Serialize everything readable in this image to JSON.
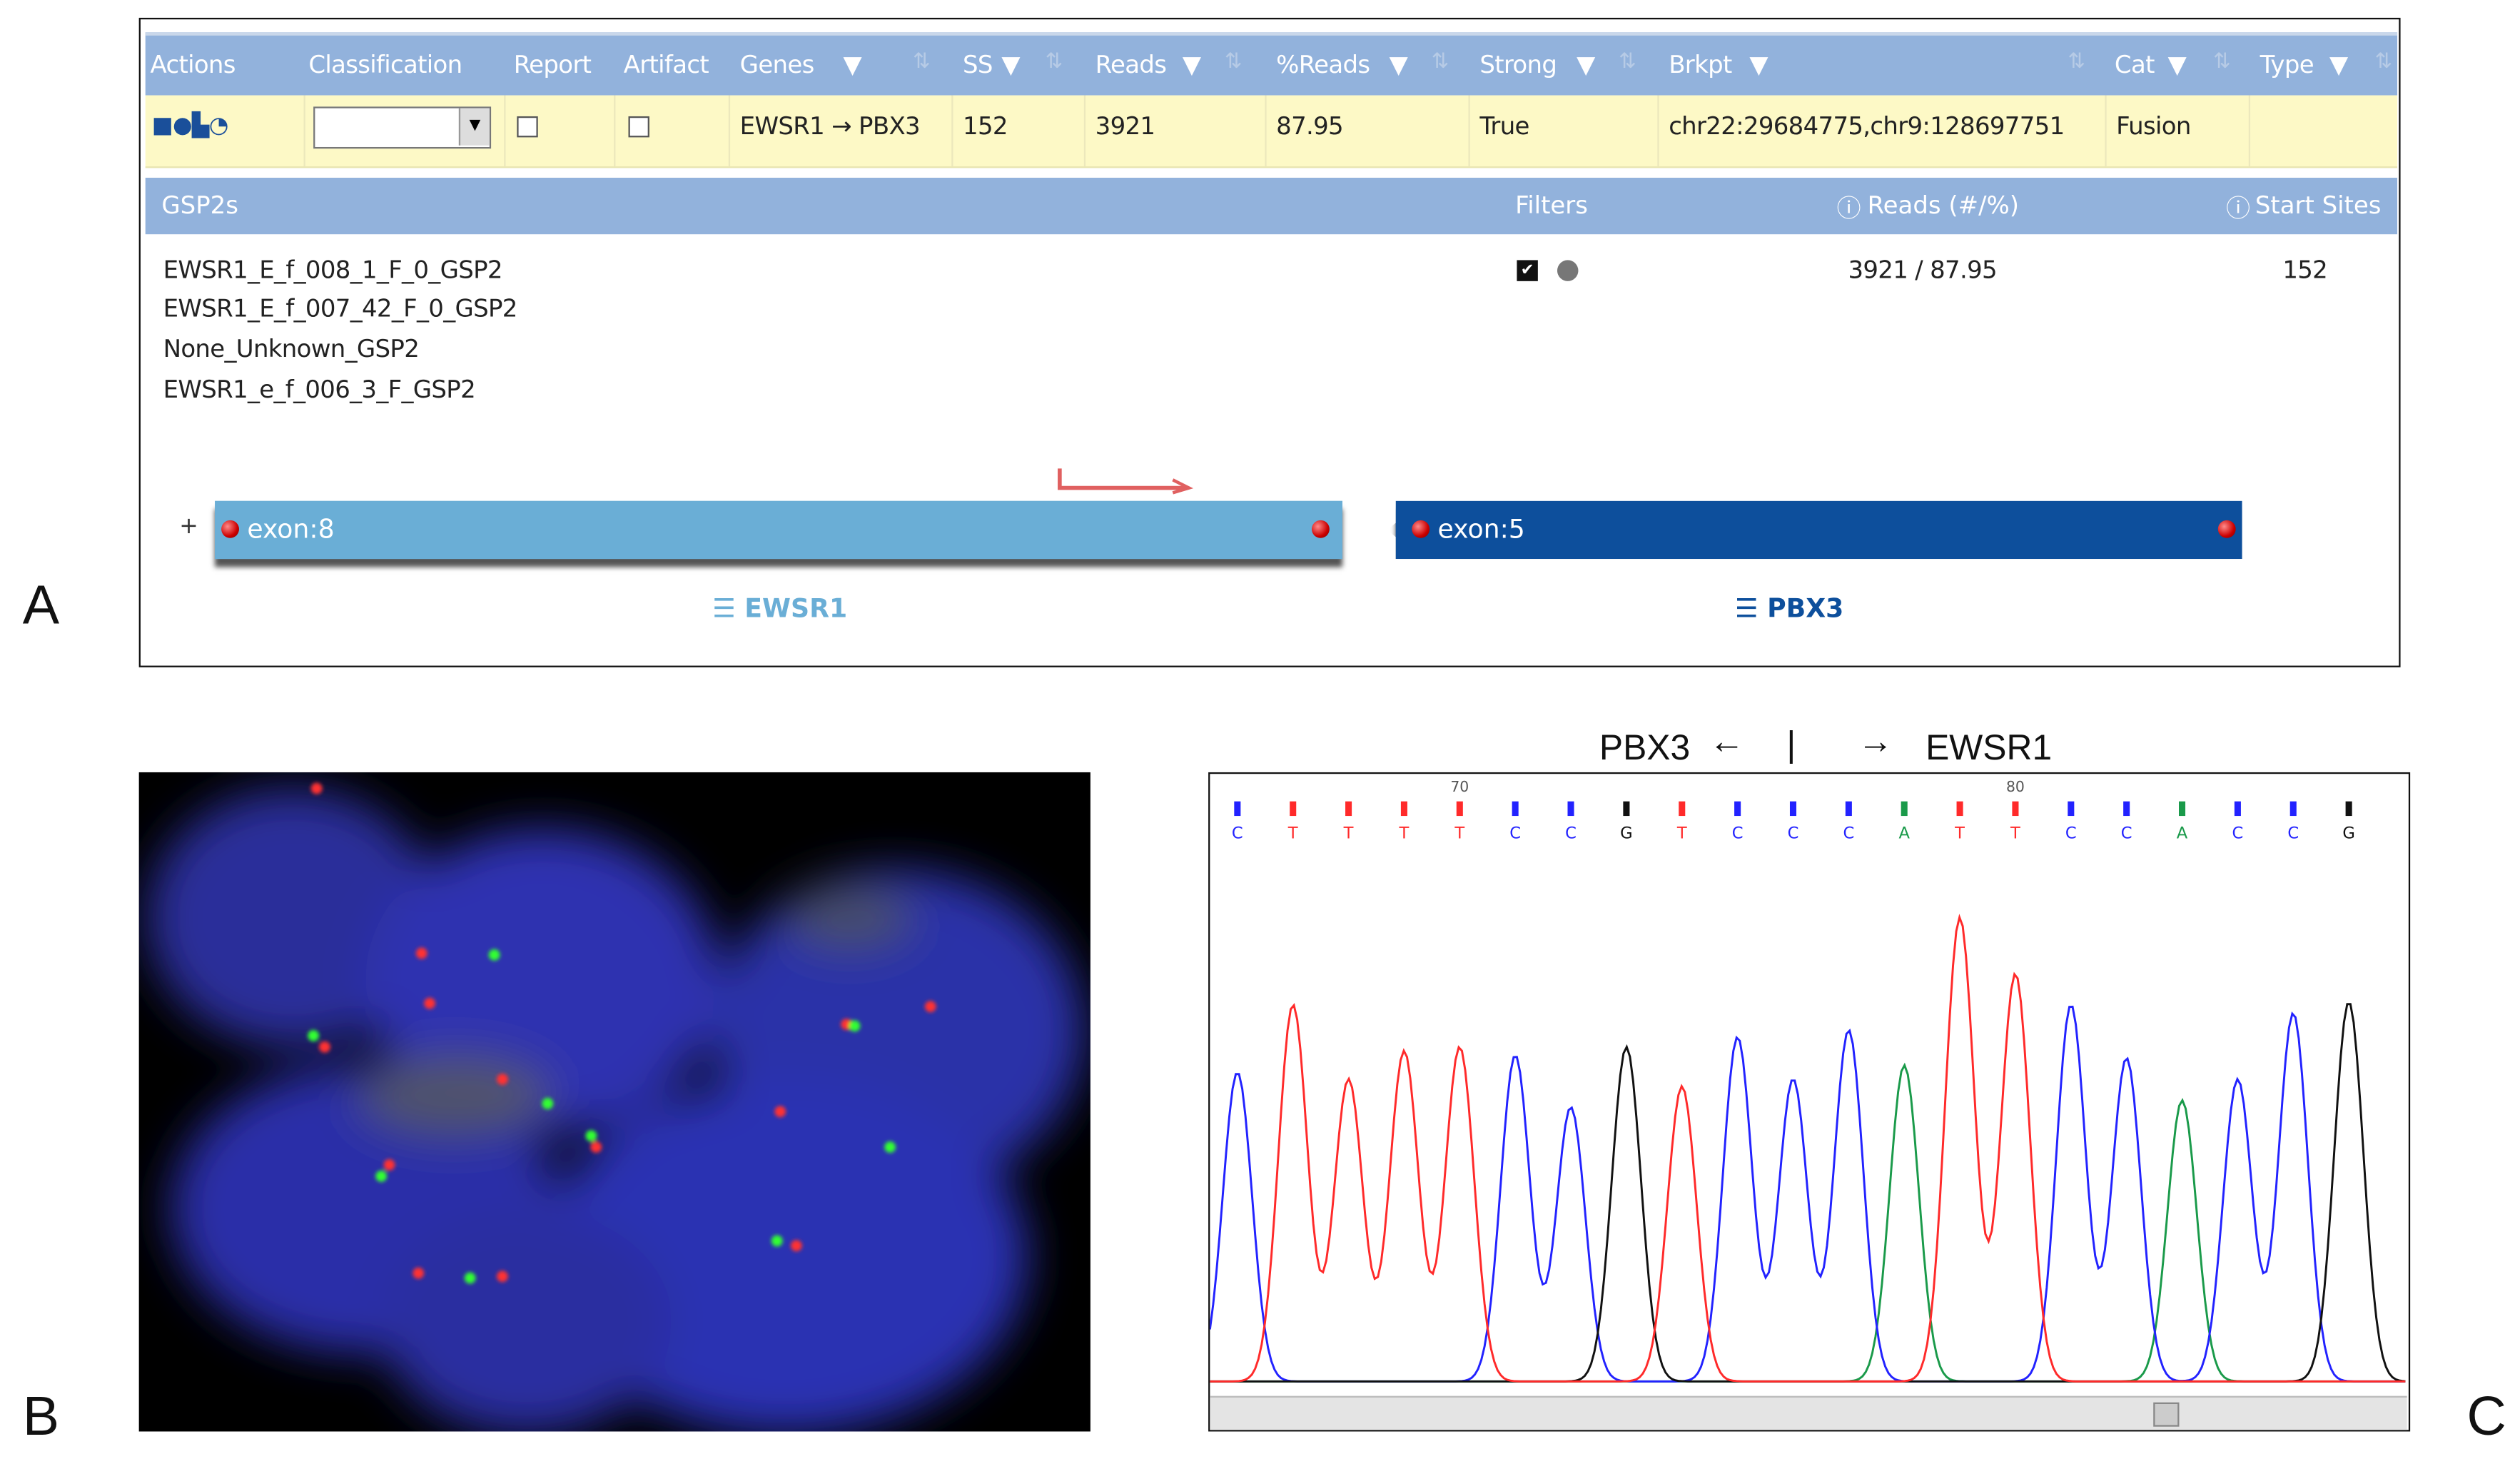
{
  "panel_labels": {
    "a": "A",
    "b": "B",
    "c": "C"
  },
  "fusion_table": {
    "columns": [
      "Actions",
      "Classification",
      "Report",
      "Artifact",
      "Genes",
      "SS",
      "Reads",
      "%Reads",
      "Strong",
      "Brkpt",
      "Cat",
      "Type"
    ],
    "row": {
      "action_icons": [
        "save-icon",
        "comments-icon",
        "chart-icon",
        "pie-icon"
      ],
      "classification": "",
      "report_checked": false,
      "artifact_checked": false,
      "genes": "EWSR1 → PBX3",
      "ss": "152",
      "reads": "3921",
      "pct_reads": "87.95",
      "strong": "True",
      "brkpt": "chr22:29684775,chr9:128697751",
      "cat": "Fusion",
      "type": ""
    }
  },
  "gsp2_table": {
    "headers": {
      "gsp2s": "GSP2s",
      "filters": "Filters",
      "reads": "Reads (#/%)",
      "start_sites": "Start Sites"
    },
    "primers": [
      "EWSR1_E_f_008_1_F_0_GSP2",
      "EWSR1_E_f_007_42_F_0_GSP2",
      "None_Unknown_GSP2",
      "EWSR1_e_f_006_3_F_GSP2"
    ],
    "reads": "3921 / 87.95",
    "start_sites": "152"
  },
  "fusion_diagram": {
    "strand": "+",
    "exon_left": "exon:8",
    "exon_right": "exon:5",
    "gene_left": "EWSR1",
    "gene_right": "PBX3",
    "colors": {
      "left": "#6aaed6",
      "right": "#0d4f9c",
      "link": "#2a7fc0",
      "arrow": "#e06060"
    }
  },
  "chromatogram": {
    "left_label": "PBX3",
    "right_label": "EWSR1",
    "separator": "|",
    "chart_data": {
      "type": "line",
      "title": "Sanger sequencing chromatogram",
      "position_ticks": [
        {
          "label": "70",
          "base_index": 4
        },
        {
          "label": "80",
          "base_index": 14
        }
      ],
      "bases": [
        "C",
        "T",
        "T",
        "T",
        "T",
        "C",
        "C",
        "G",
        "T",
        "C",
        "C",
        "C",
        "A",
        "T",
        "T",
        "C",
        "C",
        "A",
        "C",
        "C",
        "G"
      ],
      "peak_heights": [
        220,
        268,
        215,
        235,
        238,
        232,
        195,
        238,
        210,
        245,
        215,
        250,
        225,
        330,
        290,
        268,
        230,
        200,
        215,
        262,
        270
      ],
      "ylim": [
        0,
        380
      ],
      "colors": {
        "A": "#1a9a4a",
        "C": "#2222ff",
        "G": "#111111",
        "T": "#ff2a2a"
      }
    }
  }
}
